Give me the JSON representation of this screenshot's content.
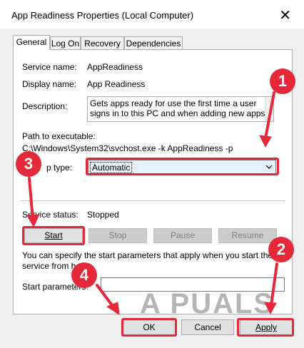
{
  "window": {
    "title": "App Readiness Properties (Local Computer)",
    "close_glyph": "✕"
  },
  "tabs": [
    {
      "label": "General",
      "active": true
    },
    {
      "label": "Log On",
      "active": false
    },
    {
      "label": "Recovery",
      "active": false
    },
    {
      "label": "Dependencies",
      "active": false
    }
  ],
  "general": {
    "service_name_label": "Service name:",
    "service_name_value": "AppReadiness",
    "display_name_label": "Display name:",
    "display_name_value": "App Readiness",
    "description_label": "Description:",
    "description_value": "Gets apps ready for use the first time a user signs in to this PC and when adding new apps.",
    "path_label": "Path to executable:",
    "path_value": "C:\\Windows\\System32\\svchost.exe -k AppReadiness -p",
    "startup_type_label": "p type:",
    "startup_type_value": "Automatic",
    "service_status_label": "Service status:",
    "service_status_value": "Stopped",
    "buttons": {
      "start": "Start",
      "stop": "Stop",
      "pause": "Pause",
      "resume": "Resume"
    },
    "params_text": "You can specify the start parameters that apply when you start the service from here.",
    "start_params_label": "Start parameters:",
    "start_params_value": ""
  },
  "footer": {
    "ok": "OK",
    "cancel": "Cancel",
    "apply": "Apply"
  },
  "annotations": {
    "badges": [
      "1",
      "2",
      "3",
      "4"
    ],
    "color": "#e5283a"
  },
  "watermark": "A  PUALS"
}
